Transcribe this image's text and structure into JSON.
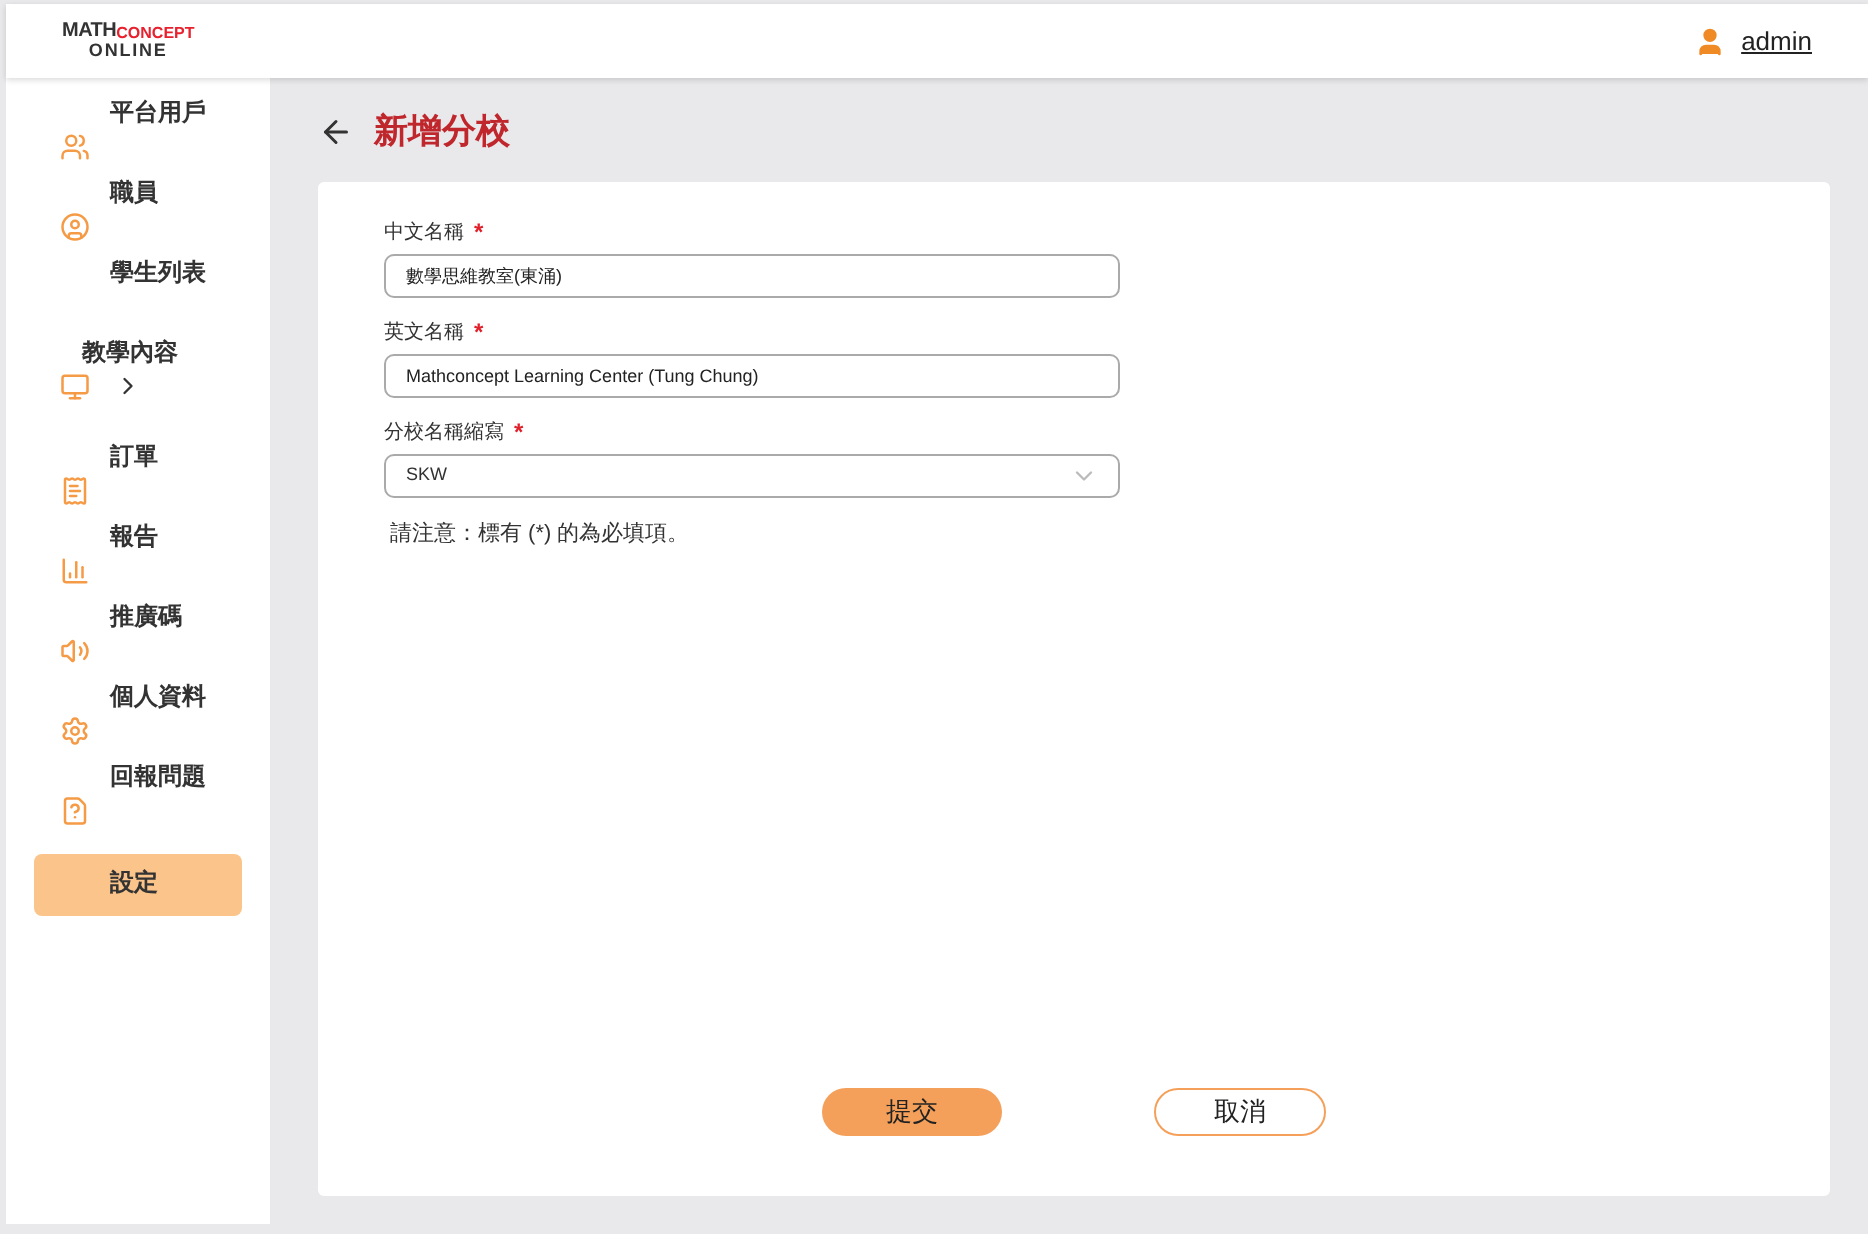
{
  "header": {
    "logo": {
      "top_left": "MATH",
      "top_right": "CONCEPT",
      "bottom": "ONLINE"
    },
    "user": "admin"
  },
  "sidebar": {
    "items": [
      {
        "label": "平台用戶",
        "selected": false
      },
      {
        "label": "職員",
        "selected": false
      },
      {
        "label": "學生列表",
        "selected": false
      },
      {
        "label": "教學內容",
        "expandable": true,
        "selected": false
      },
      {
        "label": "訂單",
        "selected": false
      },
      {
        "label": "報告",
        "selected": false
      },
      {
        "label": "推廣碼",
        "selected": false
      },
      {
        "label": "個人資料",
        "selected": false
      },
      {
        "label": "回報問題",
        "selected": false
      },
      {
        "label": "設定",
        "selected": true
      }
    ]
  },
  "page": {
    "title": "新增分校",
    "fields": [
      {
        "label": "中文名稱",
        "required": "*",
        "kind": "text",
        "value": "數學思維教室(東涌)"
      },
      {
        "label": "英文名稱",
        "required": "*",
        "kind": "text",
        "value": "Mathconcept Learning Center (Tung Chung)"
      },
      {
        "label": "分校名稱縮寫",
        "required": "*",
        "kind": "select",
        "value": "SKW"
      }
    ],
    "note": "請注意：標有 (*) 的為必填項。",
    "buttons": [
      {
        "label": "提交",
        "kind": "primary"
      },
      {
        "label": "取消",
        "kind": "secondary"
      }
    ]
  }
}
